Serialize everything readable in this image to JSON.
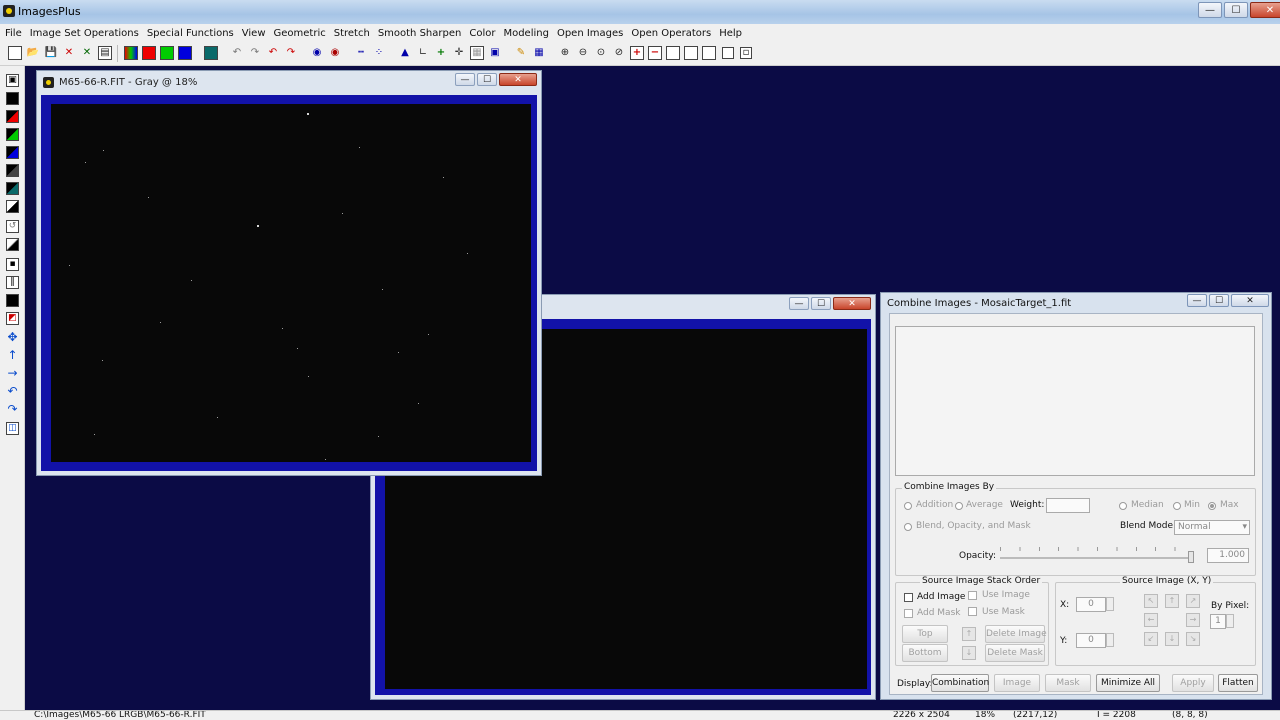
{
  "app": {
    "title": "ImagesPlus"
  },
  "menu": [
    "File",
    "Image Set Operations",
    "Special Functions",
    "View",
    "Geometric",
    "Stretch",
    "Smooth Sharpen",
    "Color",
    "Modeling",
    "Open Images",
    "Open Operators",
    "Help"
  ],
  "window_controls": {
    "minimize": "—",
    "maximize": "☐",
    "close": "✕"
  },
  "image_window_1": {
    "title": "M65-66-R.FIT - Gray @ 18%"
  },
  "combine_dialog": {
    "title": "Combine Images - MosaicTarget_1.fit",
    "combine_by": {
      "group_title": "Combine Images By",
      "addition": "Addition",
      "average": "Average",
      "weight_label": "Weight:",
      "median": "Median",
      "min": "Min",
      "max": "Max",
      "blend_opacity_mask": "Blend, Opacity, and Mask",
      "blend_mode_label": "Blend Mode:",
      "blend_mode_value": "Normal",
      "opacity_label": "Opacity:",
      "opacity_value": "1.000"
    },
    "stack_order": {
      "group_title": "Source Image Stack Order",
      "add_image": "Add Image",
      "use_image": "Use Image",
      "add_mask": "Add Mask",
      "use_mask": "Use Mask",
      "top": "Top",
      "bottom": "Bottom",
      "delete_image": "Delete Image",
      "delete_mask": "Delete Mask"
    },
    "source_xy": {
      "group_title": "Source Image (X, Y)",
      "x_label": "X:",
      "x_value": "0",
      "y_label": "Y:",
      "y_value": "0",
      "by_pixel_label": "By Pixel:",
      "by_pixel_value": "1"
    },
    "display": {
      "label": "Display:",
      "combination": "Combination",
      "image": "Image",
      "mask": "Mask",
      "minimize_all": "Minimize All",
      "apply": "Apply",
      "flatten": "Flatten"
    }
  },
  "status": {
    "path": "C:\\Images\\M65-66 LRGB\\M65-66-R.FIT",
    "size": "2226 x 2504",
    "zoom": "18%",
    "coords": "(2217,12)",
    "intensity": "I = 2208",
    "rgb": "(8, 8, 8)"
  }
}
